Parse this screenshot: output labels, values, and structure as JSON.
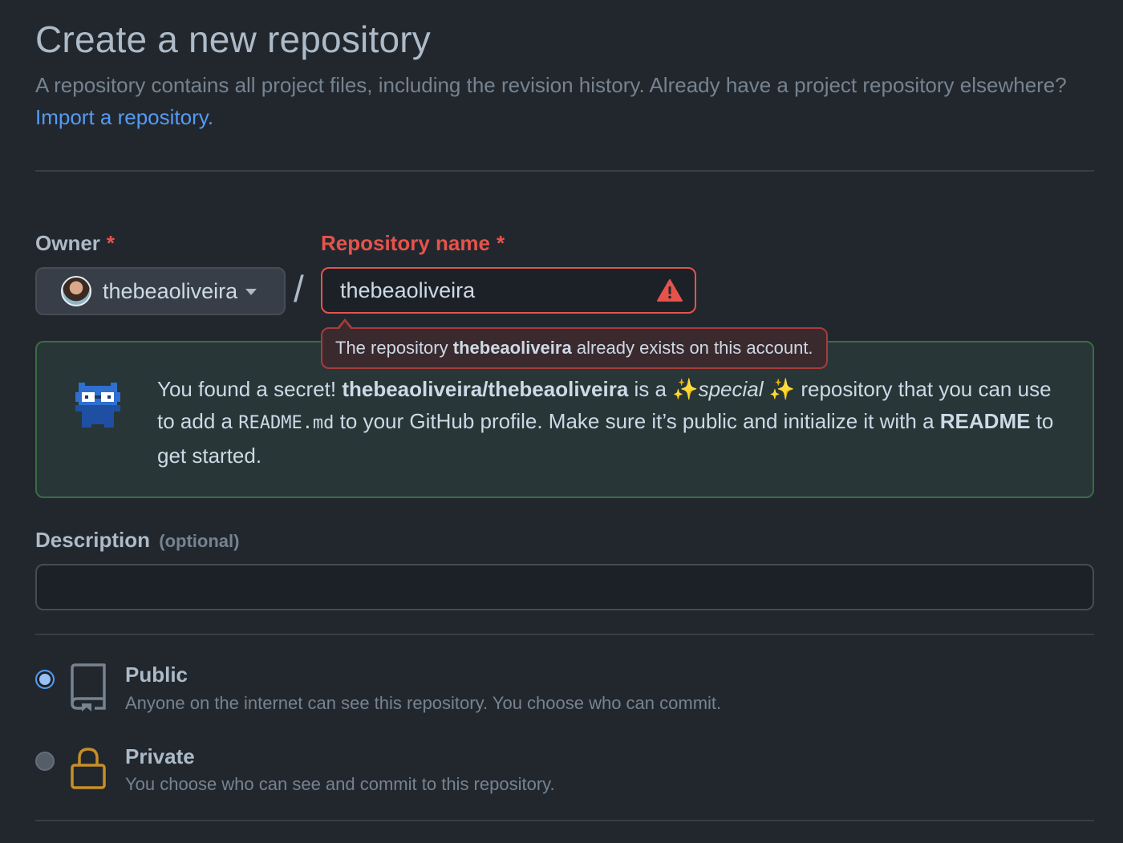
{
  "header": {
    "title": "Create a new repository",
    "subtitle": "A repository contains all project files, including the revision history. Already have a project repository elsewhere?",
    "import_link": "Import a repository."
  },
  "owner": {
    "label": "Owner",
    "required_mark": "*",
    "value": "thebeaoliveira"
  },
  "separator": "/",
  "repo_name": {
    "label": "Repository name",
    "required_mark": "*",
    "value": "thebeaoliveira",
    "error_prefix": "The repository",
    "error_name": "thebeaoliveira",
    "error_suffix": "already exists on this account."
  },
  "secret": {
    "t1": "You found a secret!",
    "path": "thebeaoliveira/thebeaoliveira",
    "t2": "is a ✨",
    "special": "special",
    "t3": "✨ repository that you can use to add a",
    "code": "README.md",
    "t4": "to your GitHub profile. Make sure it’s public and initialize it with a",
    "readme": "README",
    "t5": "to get started."
  },
  "description": {
    "label": "Description",
    "optional": "(optional)",
    "value": ""
  },
  "visibility": {
    "public": {
      "title": "Public",
      "desc": "Anyone on the internet can see this repository. You choose who can commit.",
      "selected": true
    },
    "private": {
      "title": "Private",
      "desc": "You choose who can see and commit to this repository.",
      "selected": false
    }
  },
  "colors": {
    "background": "#22272e",
    "accent": "#539bf5",
    "error": "#e5534b",
    "success_border": "#3b6b45",
    "lock": "#c69026"
  }
}
